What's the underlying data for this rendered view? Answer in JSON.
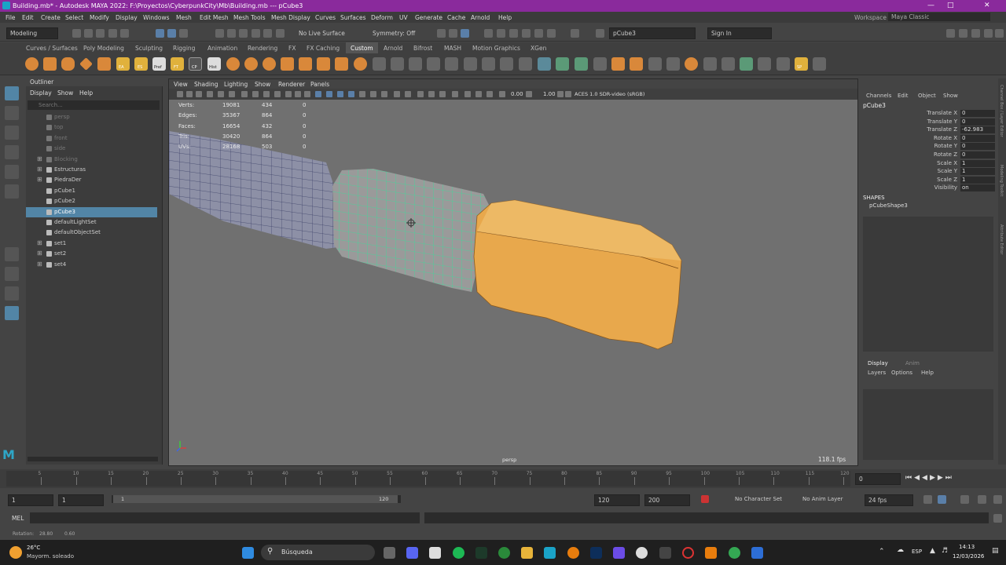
{
  "window": {
    "title": "Building.mb* - Autodesk MAYA 2022: F:\\Proyectos\\CyberpunkCity\\Mb\\Building.mb   ---   pCube3",
    "title_color": "#8a2a9c"
  },
  "menubar": [
    "File",
    "Edit",
    "Create",
    "Select",
    "Modify",
    "Display",
    "Windows",
    "Mesh",
    "Edit Mesh",
    "Mesh Tools",
    "Mesh Display",
    "Curves",
    "Surfaces",
    "Deform",
    "UV",
    "Generate",
    "Cache",
    "Arnold",
    "Help"
  ],
  "workspace": {
    "label": "Workspace :",
    "value": "Maya Classic"
  },
  "statusline": {
    "mode": "Modeling",
    "live_surface": "No Live Surface",
    "symmetry": "Symmetry: Off",
    "object_field": "pCube3",
    "signin": "Sign In"
  },
  "shelf_tabs": [
    "Curves / Surfaces",
    "Poly Modeling",
    "Sculpting",
    "Rigging",
    "Animation",
    "Rendering",
    "FX",
    "FX Caching",
    "Custom",
    "Arnold",
    "Bifrost",
    "MASH",
    "Motion Graphics",
    "XGen"
  ],
  "shelf_active": "Custom",
  "shelf_labels": [
    "EA",
    "ES",
    "Pref",
    "FT",
    "CP",
    "Hist",
    "SP"
  ],
  "outliner": {
    "title": "Outliner",
    "menu": [
      "Display",
      "Show",
      "Help"
    ],
    "search_placeholder": "Search...",
    "items": [
      {
        "label": "persp",
        "dim": true,
        "exp": false
      },
      {
        "label": "top",
        "dim": true,
        "exp": false
      },
      {
        "label": "front",
        "dim": true,
        "exp": false
      },
      {
        "label": "side",
        "dim": true,
        "exp": false
      },
      {
        "label": "Blocking",
        "dim": true,
        "exp": true
      },
      {
        "label": "Estructuras",
        "dim": false,
        "exp": true
      },
      {
        "label": "PiedraDer",
        "dim": false,
        "exp": true
      },
      {
        "label": "pCube1",
        "dim": false,
        "exp": false
      },
      {
        "label": "pCube2",
        "dim": false,
        "exp": false
      },
      {
        "label": "pCube3",
        "dim": false,
        "exp": false,
        "selected": true
      },
      {
        "label": "defaultLightSet",
        "dim": false,
        "exp": false
      },
      {
        "label": "defaultObjectSet",
        "dim": false,
        "exp": false
      },
      {
        "label": "set1",
        "dim": false,
        "exp": true
      },
      {
        "label": "set2",
        "dim": false,
        "exp": true
      },
      {
        "label": "set4",
        "dim": false,
        "exp": true
      }
    ]
  },
  "viewport": {
    "menu": [
      "View",
      "Shading",
      "Lighting",
      "Show",
      "Renderer",
      "Panels"
    ],
    "near": "0.00",
    "far": "1.00",
    "colorspace": "ACES 1.0 SDR-video (sRGB)",
    "hud": [
      {
        "label": "Verts:",
        "total": "19081",
        "sel": "434",
        "comp": "0"
      },
      {
        "label": "Edges:",
        "total": "35367",
        "sel": "864",
        "comp": "0"
      },
      {
        "label": "Faces:",
        "total": "16654",
        "sel": "432",
        "comp": "0"
      },
      {
        "label": "Tris:",
        "total": "30420",
        "sel": "864",
        "comp": "0"
      },
      {
        "label": "UVs:",
        "total": "28168",
        "sel": "503",
        "comp": "0"
      }
    ],
    "camera": "persp",
    "fps": "118.1 fps"
  },
  "channelbox": {
    "menu": [
      "Channels",
      "Edit",
      "Object",
      "Show"
    ],
    "object": "pCube3",
    "channels": [
      {
        "name": "Translate X",
        "value": "0"
      },
      {
        "name": "Translate Y",
        "value": "0"
      },
      {
        "name": "Translate Z",
        "value": "-62.983"
      },
      {
        "name": "Rotate X",
        "value": "0"
      },
      {
        "name": "Rotate Y",
        "value": "0"
      },
      {
        "name": "Rotate Z",
        "value": "0"
      },
      {
        "name": "Scale X",
        "value": "1"
      },
      {
        "name": "Scale Y",
        "value": "1"
      },
      {
        "name": "Scale Z",
        "value": "1"
      },
      {
        "name": "Visibility",
        "value": "on"
      }
    ],
    "shapes_title": "SHAPES",
    "shape": "pCubeShape3",
    "layer_tabs": [
      "Display",
      "Anim"
    ],
    "layer_menu": [
      "Layers",
      "Options",
      "Help"
    ],
    "side_tabs": [
      "Channel Box / Layer Editor",
      "Modeling Toolkit",
      "Attribute Editor"
    ]
  },
  "timeline": {
    "ticks": [
      "5",
      "10",
      "15",
      "20",
      "25",
      "30",
      "35",
      "40",
      "45",
      "50",
      "55",
      "60",
      "65",
      "70",
      "75",
      "80",
      "85",
      "90",
      "95",
      "100",
      "105",
      "110",
      "115",
      "120"
    ],
    "current": "0"
  },
  "range": {
    "start": "1",
    "start2": "1",
    "slider_start": "1",
    "slider_end": "120",
    "end": "120",
    "end2": "200",
    "char_set": "No Character Set",
    "anim_layer": "No Anim Layer",
    "fps": "24 fps"
  },
  "cmd": {
    "lang": "MEL"
  },
  "help_line": {
    "label": "Rotation:",
    "a": "28.80",
    "b": "0.60"
  },
  "taskbar": {
    "weather_temp": "26°C",
    "weather_desc": "Mayorm. soleado",
    "search": "Búsqueda",
    "lang": "ESP",
    "time": "14:13",
    "date": "12/03/2026"
  }
}
